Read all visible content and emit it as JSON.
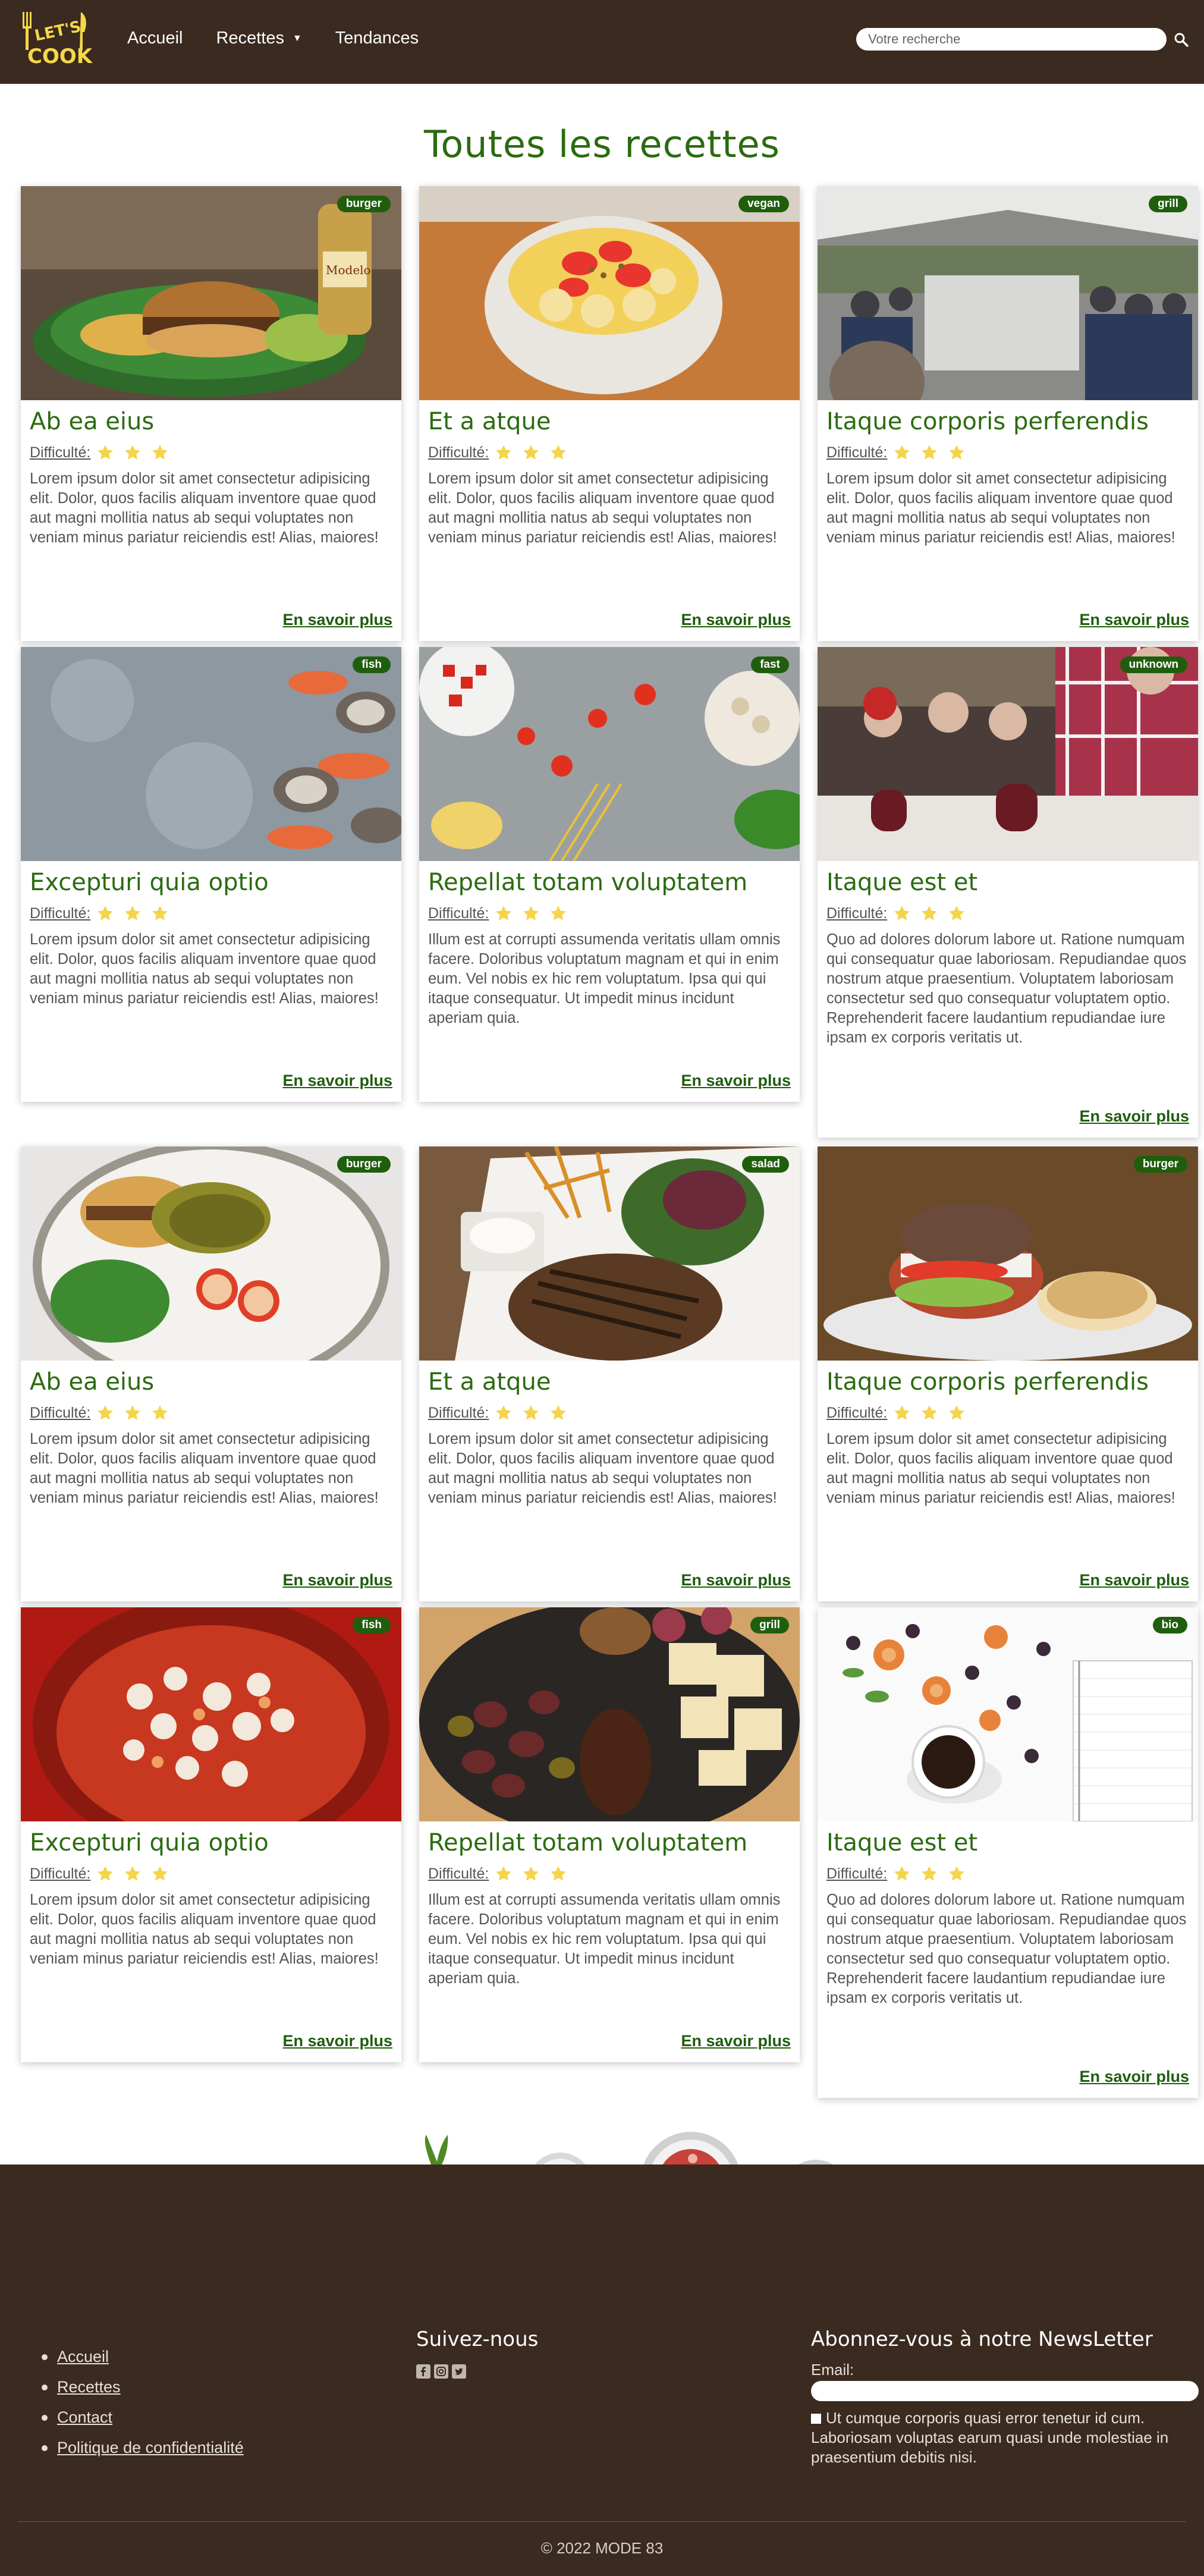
{
  "header": {
    "logo_text": "LET'S COOK",
    "nav": [
      {
        "label": "Accueil"
      },
      {
        "label": "Recettes",
        "caret": "▼"
      },
      {
        "label": "Tendances"
      }
    ],
    "search_placeholder": "Votre recherche",
    "search_icon": "search-icon"
  },
  "page_title": "Toutes les recettes",
  "difficulty_label": "Difficulté:",
  "more_label": "En savoir plus",
  "star_color": "#f5d44a",
  "accent_color": "#2b6b10",
  "cards": [
    {
      "title": "Ab ea eius",
      "badge": "burger",
      "stars": 3,
      "desc": "Lorem ipsum dolor sit amet consectetur adipisicing elit. Dolor, quos facilis aliquam inventore quae quod aut magni mollitia natus ab sequi voluptates non veniam minus pariatur reiciendis est! Alias, maiores!"
    },
    {
      "title": "Et a atque",
      "badge": "vegan",
      "stars": 3,
      "desc": "Lorem ipsum dolor sit amet consectetur adipisicing elit. Dolor, quos facilis aliquam inventore quae quod aut magni mollitia natus ab sequi voluptates non veniam minus pariatur reiciendis est! Alias, maiores!"
    },
    {
      "title": "Itaque corporis perferendis",
      "badge": "grill",
      "stars": 3,
      "desc": "Lorem ipsum dolor sit amet consectetur adipisicing elit. Dolor, quos facilis aliquam inventore quae quod aut magni mollitia natus ab sequi voluptates non veniam minus pariatur reiciendis est! Alias, maiores!"
    },
    {
      "title": "Excepturi quia optio",
      "badge": "fish",
      "stars": 3,
      "desc": "Lorem ipsum dolor sit amet consectetur adipisicing elit. Dolor, quos facilis aliquam inventore quae quod aut magni mollitia natus ab sequi voluptates non veniam minus pariatur reiciendis est! Alias, maiores!"
    },
    {
      "title": "Repellat totam voluptatem",
      "badge": "fast",
      "stars": 3,
      "desc": "Illum est at corrupti assumenda veritatis ullam omnis facere. Doloribus voluptatum magnam et qui in enim eum. Vel nobis ex hic rem voluptatum. Ipsa qui qui itaque consequatur. Ut impedit minus incidunt aperiam quia."
    },
    {
      "title": "Itaque est et",
      "badge": "unknown",
      "stars": 3,
      "desc": "Quo ad dolores dolorum labore ut. Ratione numquam qui consequatur quae laboriosam. Repudiandae quos nostrum atque praesentium. Voluptatem laboriosam consectetur sed quo consequatur voluptatem optio. Reprehenderit facere laudantium repudiandae iure ipsam ex corporis veritatis ut."
    },
    {
      "title": "Ab ea eius",
      "badge": "burger",
      "stars": 3,
      "desc": "Lorem ipsum dolor sit amet consectetur adipisicing elit. Dolor, quos facilis aliquam inventore quae quod aut magni mollitia natus ab sequi voluptates non veniam minus pariatur reiciendis est! Alias, maiores!"
    },
    {
      "title": "Et a atque",
      "badge": "salad",
      "stars": 3,
      "desc": "Lorem ipsum dolor sit amet consectetur adipisicing elit. Dolor, quos facilis aliquam inventore quae quod aut magni mollitia natus ab sequi voluptates non veniam minus pariatur reiciendis est! Alias, maiores!"
    },
    {
      "title": "Itaque corporis perferendis",
      "badge": "burger",
      "stars": 3,
      "desc": "Lorem ipsum dolor sit amet consectetur adipisicing elit. Dolor, quos facilis aliquam inventore quae quod aut magni mollitia natus ab sequi voluptates non veniam minus pariatur reiciendis est! Alias, maiores!"
    },
    {
      "title": "Excepturi quia optio",
      "badge": "fish",
      "stars": 3,
      "desc": "Lorem ipsum dolor sit amet consectetur adipisicing elit. Dolor, quos facilis aliquam inventore quae quod aut magni mollitia natus ab sequi voluptates non veniam minus pariatur reiciendis est! Alias, maiores!"
    },
    {
      "title": "Repellat totam voluptatem",
      "badge": "grill",
      "stars": 3,
      "desc": "Illum est at corrupti assumenda veritatis ullam omnis facere. Doloribus voluptatum magnam et qui in enim eum. Vel nobis ex hic rem voluptatum. Ipsa qui qui itaque consequatur. Ut impedit minus incidunt aperiam quia."
    },
    {
      "title": "Itaque est et",
      "badge": "bio",
      "stars": 3,
      "desc": "Quo ad dolores dolorum labore ut. Ratione numquam qui consequatur quae laboriosam. Repudiandae quos nostrum atque praesentium. Voluptatem laboriosam consectetur sed quo consequatur voluptatem optio. Reprehenderit facere laudantium repudiandae iure ipsam ex corporis veritatis ut."
    }
  ],
  "footer": {
    "links": [
      {
        "label": "Accueil"
      },
      {
        "label": "Recettes"
      },
      {
        "label": "Contact"
      },
      {
        "label": "Politique de confidentialité"
      }
    ],
    "follow_title": "Suivez-nous",
    "socials": [
      "facebook-icon",
      "instagram-icon",
      "twitter-icon"
    ],
    "newsletter_title": "Abonnez-vous à notre NewsLetter",
    "email_label": "Email:",
    "consent_text": "Ut cumque corporis quasi error tenetur id cum. Laboriosam voluptas earum quasi unde molestiae in praesentium debitis nisi.",
    "copyright": "© 2022 MODE 83"
  }
}
